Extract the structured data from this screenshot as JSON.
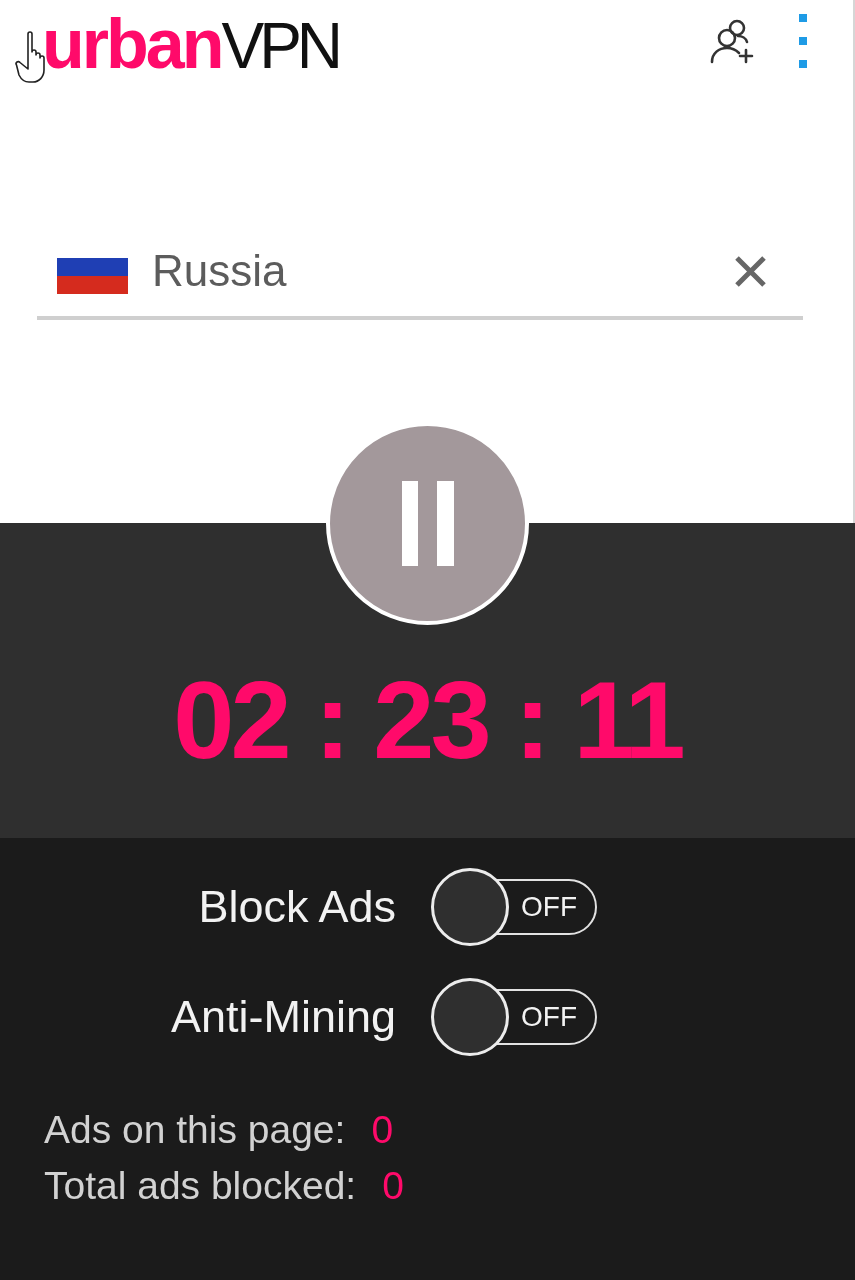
{
  "header": {
    "logo": [
      {
        "text": "urban",
        "kind": "accent"
      },
      {
        "text": "VPN",
        "kind": "plain"
      }
    ]
  },
  "location": {
    "country": "Russia"
  },
  "connection": {
    "connected": true,
    "timer": "02 : 23 : 11"
  },
  "toggles": [
    {
      "label": "Block Ads",
      "on": false,
      "state_label": "OFF"
    },
    {
      "label": "Anti-Mining",
      "on": false,
      "state_label": "OFF"
    }
  ],
  "stats": [
    {
      "label": "Ads on this page:",
      "value": "0"
    },
    {
      "label": "Total ads blocked:",
      "value": "0"
    }
  ]
}
